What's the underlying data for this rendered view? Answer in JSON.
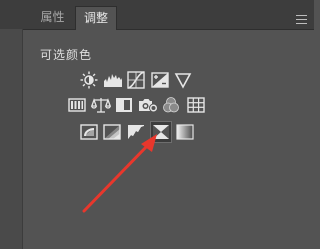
{
  "tabs": [
    {
      "label": "属性",
      "active": false
    },
    {
      "label": "调整",
      "active": true
    }
  ],
  "panel_title": "可选颜色",
  "icon_rows": [
    [
      "brightness-contrast-icon",
      "levels-icon",
      "curves-icon",
      "exposure-icon",
      "vibrance-icon"
    ],
    [
      "hue-saturation-icon",
      "color-balance-icon",
      "black-white-icon",
      "photo-filter-icon",
      "channel-mixer-icon",
      "color-lookup-icon"
    ],
    [
      "invert-icon",
      "posterize-icon",
      "threshold-icon",
      "selective-color-icon",
      "gradient-map-icon"
    ]
  ],
  "selected_icon": "selective-color-icon",
  "colors": {
    "panel_bg": "#535353",
    "tabbar_bg": "#3d3d3d",
    "icon": "#e6e6e6",
    "annotation_arrow": "#e8372c"
  }
}
